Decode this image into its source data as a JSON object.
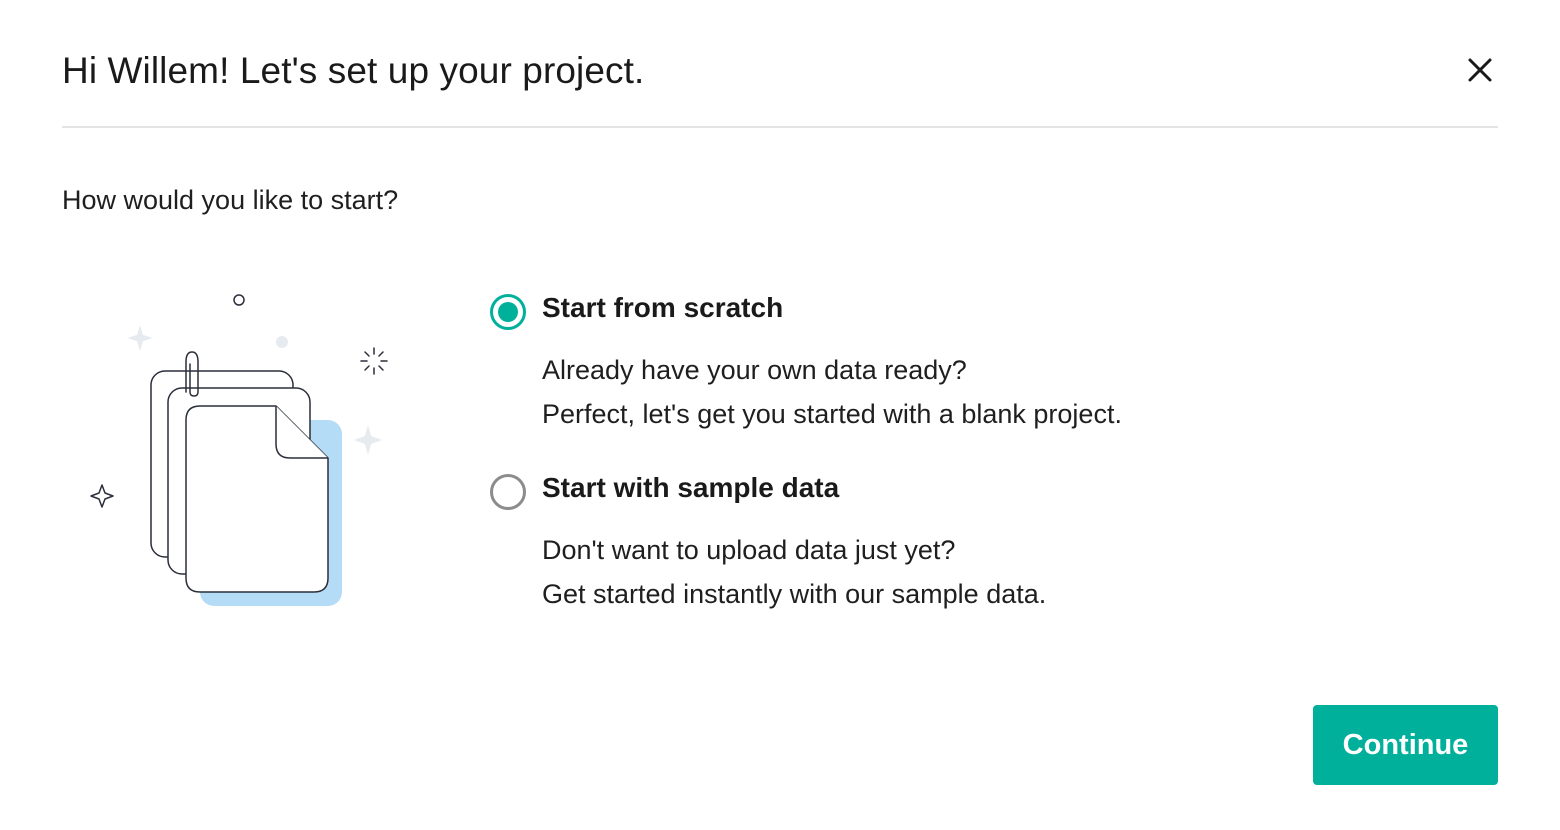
{
  "dialog": {
    "title": "Hi Willem! Let's set up your project.",
    "close_icon": "close-icon",
    "question": "How would you like to start?"
  },
  "options": [
    {
      "title": "Start from scratch",
      "desc_line1": "Already have your own data ready?",
      "desc_line2": "Perfect, let's get you started with a blank project.",
      "selected": true
    },
    {
      "title": "Start with sample data",
      "desc_line1": "Don't want to upload data just yet?",
      "desc_line2": "Get started instantly with our sample data.",
      "selected": false
    }
  ],
  "footer": {
    "continue_label": "Continue"
  },
  "colors": {
    "accent": "#00b09b",
    "divider": "#e4e4e4",
    "illustration_shadow": "#b5dcf7",
    "sparkle": "#e6ebf0",
    "outline": "#2b2f3a"
  },
  "illustration": {
    "icon": "documents-illustration-icon"
  }
}
